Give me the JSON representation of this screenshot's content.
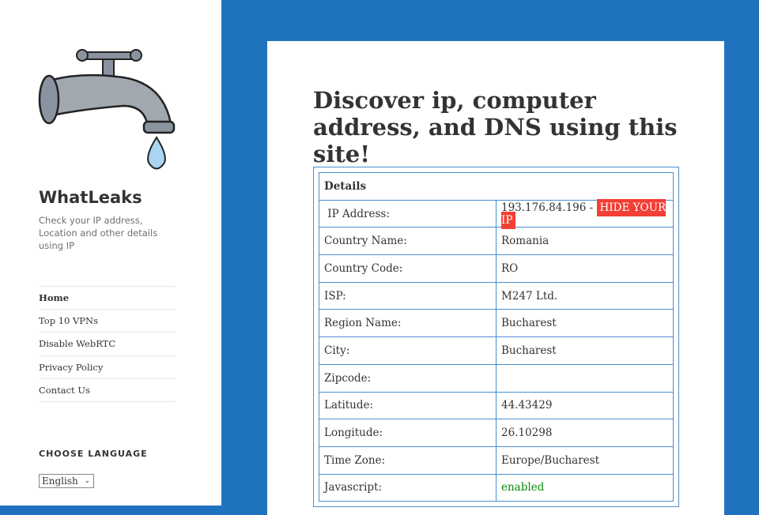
{
  "site": {
    "title": "WhatLeaks",
    "tagline": "Check your IP address, Location and other details using IP"
  },
  "nav": [
    "Home",
    "Top 10 VPNs",
    "Disable WebRTC",
    "Privacy Policy",
    "Contact Us"
  ],
  "language": {
    "heading": "CHOOSE LANGUAGE",
    "selected": "English"
  },
  "main": {
    "title": "Discover ip, computer address, and DNS using this site!",
    "table_header": "Details",
    "ip_label": "IP Address:",
    "ip_value": "193.176.84.196 -",
    "hide_ip": "HIDE YOUR IP",
    "rows": [
      [
        "Country Name:",
        "Romania"
      ],
      [
        "Country Code:",
        "RO"
      ],
      [
        "ISP:",
        "M247 Ltd."
      ],
      [
        "Region Name:",
        "Bucharest"
      ],
      [
        "City:",
        "Bucharest"
      ],
      [
        "Zipcode:",
        ""
      ],
      [
        "Latitude:",
        "44.43429"
      ],
      [
        "Longitude:",
        "26.10298"
      ],
      [
        "Time Zone:",
        "Europe/Bucharest"
      ]
    ],
    "js_label": "Javascript:",
    "js_value": "enabled"
  }
}
